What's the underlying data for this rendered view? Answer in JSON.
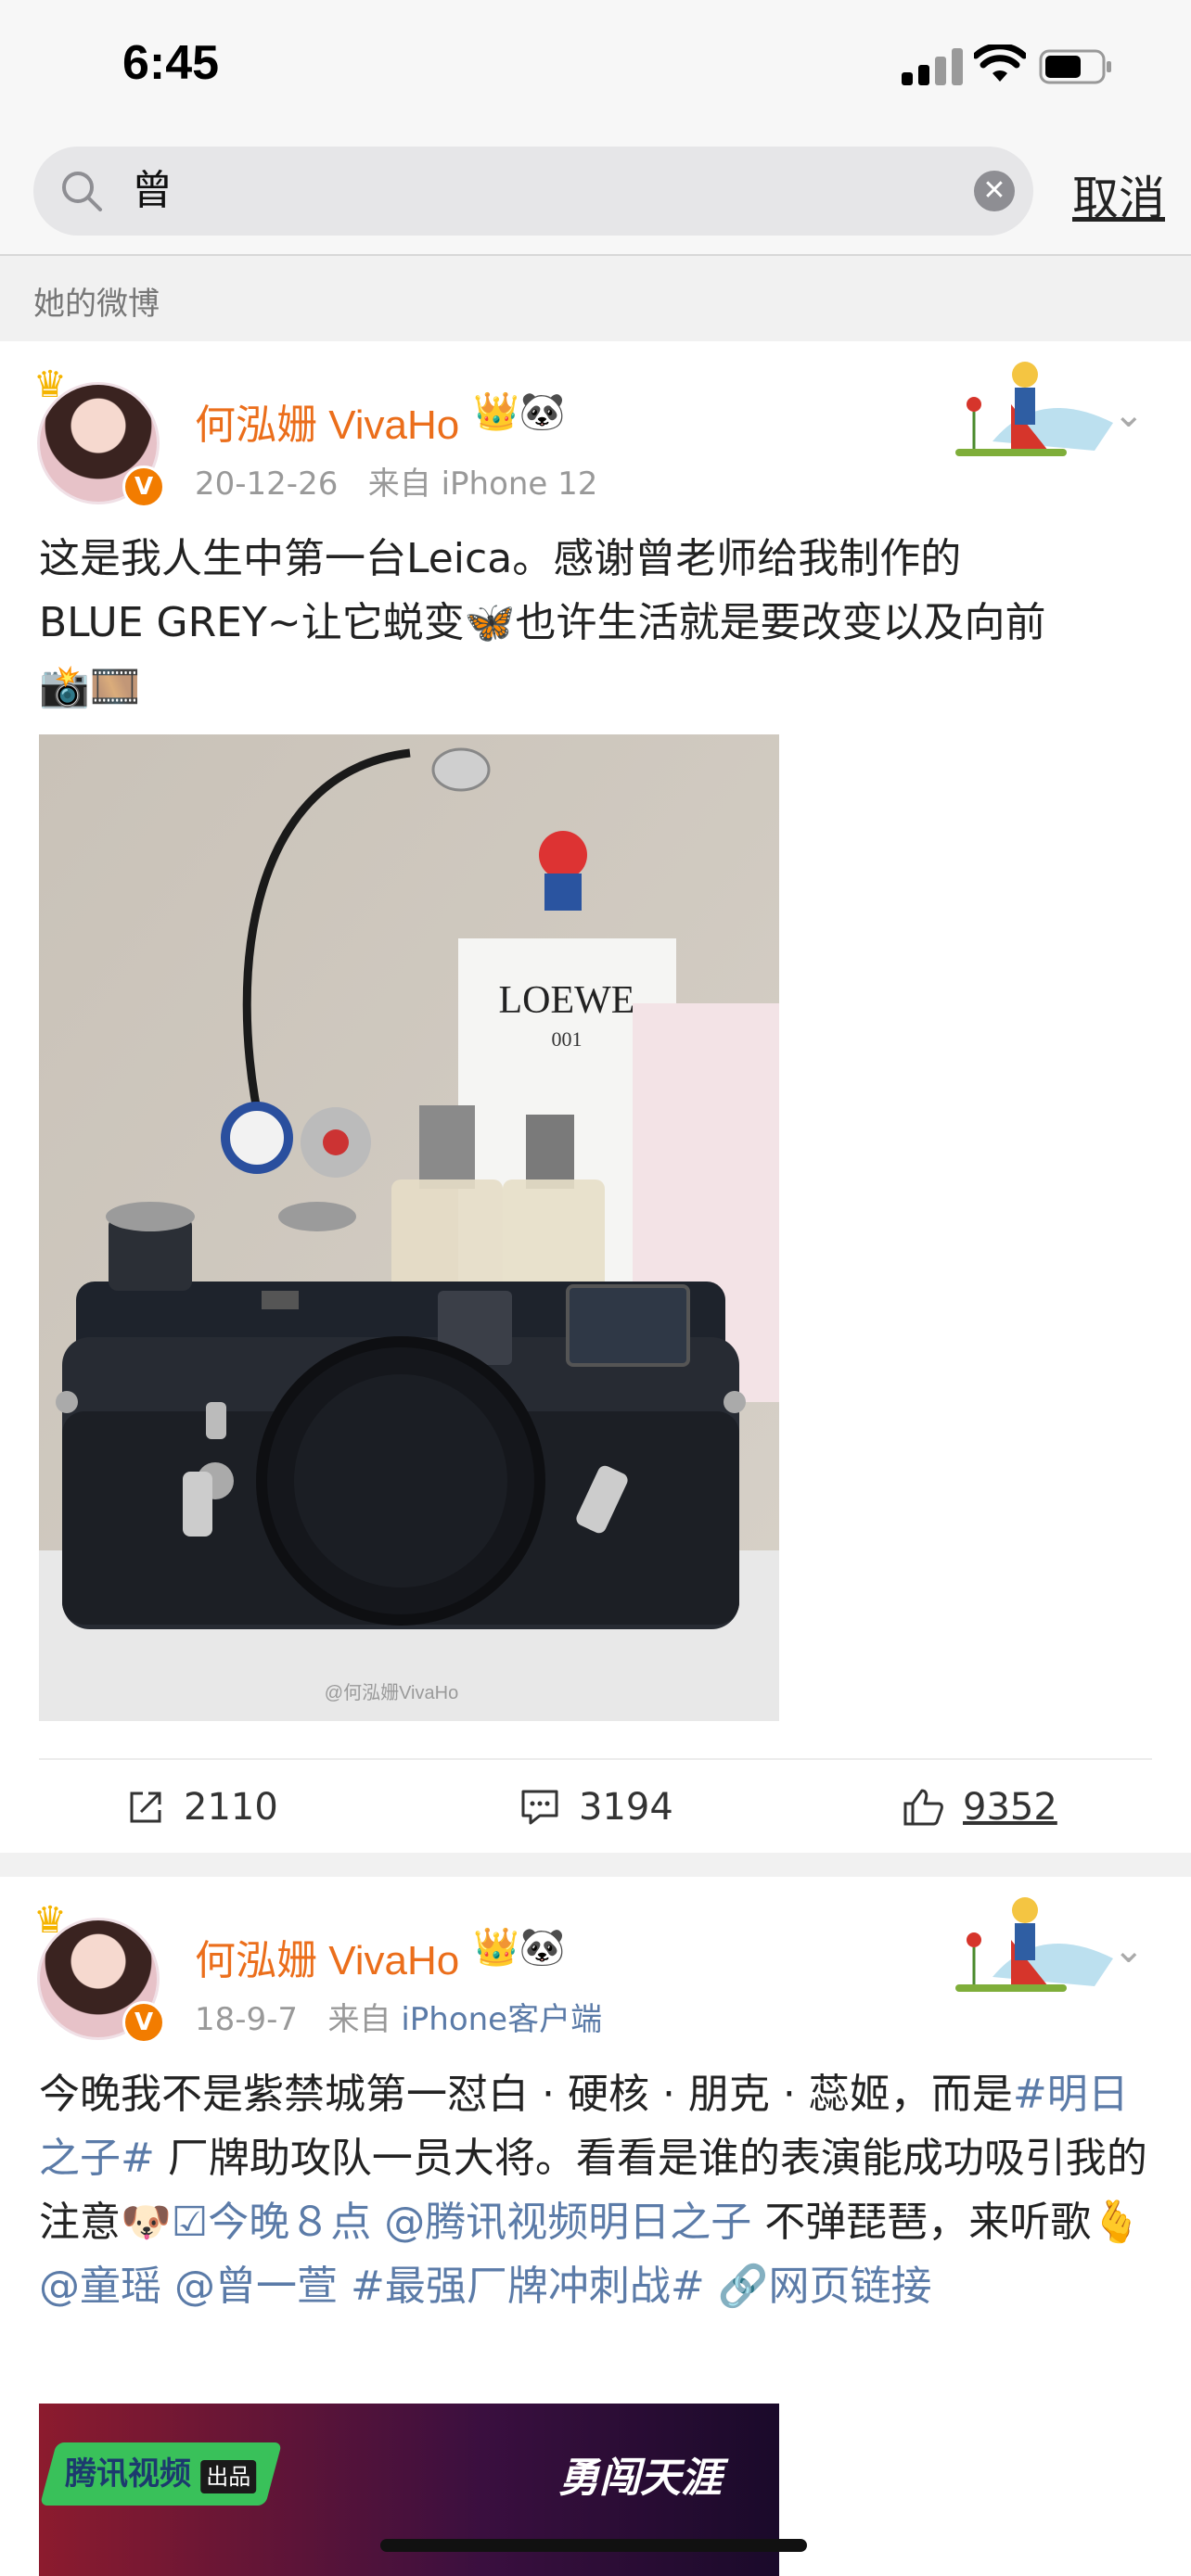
{
  "status_bar": {
    "time": "6:45"
  },
  "search": {
    "query": "曾",
    "cancel_label": "取消"
  },
  "section": {
    "label": "她的微博"
  },
  "posts": [
    {
      "username": "何泓姗 VivaHo",
      "date": "20-12-26",
      "source_prefix": "来自",
      "source": "iPhone 12",
      "text_line1": "这是我人生中第一台Leica。感谢曾老师给我制作的",
      "text_line2": "BLUE GREY~让它蜕变🦋也许生活就是要改变以及向前",
      "text_line3": "📸🎞️",
      "image_watermark": "@何泓姗VivaHo",
      "image_brand": "LOEWE",
      "image_brand_sub": "001",
      "stats": {
        "reposts": "2110",
        "comments": "3194",
        "likes": "9352"
      }
    },
    {
      "username": "何泓姗 VivaHo",
      "date": "18-9-7",
      "source_prefix": "来自",
      "source": "iPhone客户端",
      "text_a": "今晚我不是紫禁城第一怼白 · 硬核 · 朋克 · 蕊姬，而是",
      "hashtag1": "#明日之子#",
      "text_b": "厂牌助攻队一员大将。看看是谁的表演能成功吸引我的注意🐶",
      "link_tonight": "☑今晚８点",
      "mention1": "@腾讯视频明日之子",
      "text_c": "不弹琵琶，来听歌🫰",
      "mention2": "@童瑶",
      "mention3": "@曾一萱",
      "hashtag2": "#最强厂牌冲刺战#",
      "web_link": "🔗网页链接",
      "banner_left": "腾讯视频",
      "banner_tag": "出品",
      "banner_right": "勇闯天涯"
    }
  ]
}
